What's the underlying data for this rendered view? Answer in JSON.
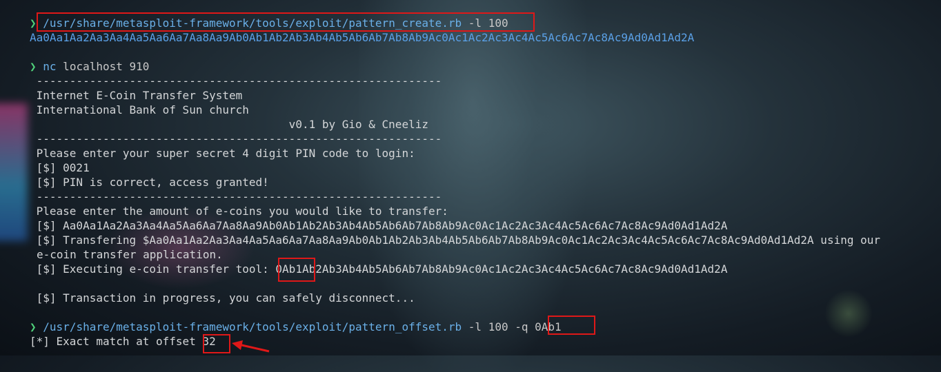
{
  "lines": {
    "cmd1": {
      "prompt": "❯",
      "cmd": "/usr/share/metasploit-framework/tools/exploit/pattern_create.rb",
      "args": " -l 100"
    },
    "pattern": "Aa0Aa1Aa2Aa3Aa4Aa5Aa6Aa7Aa8Aa9Ab0Ab1Ab2Ab3Ab4Ab5Ab6Ab7Ab8Ab9Ac0Ac1Ac2Ac3Ac4Ac5Ac6Ac7Ac8Ac9Ad0Ad1Ad2A",
    "cmd2": {
      "prompt": "❯",
      "cmd": "nc",
      "args": " localhost 910"
    },
    "sep1": " -------------------------------------------------------------",
    "title1": " Internet E-Coin Transfer System",
    "title2": " International Bank of Sun church",
    "version": "                                       v0.1 by Gio & Cneeliz",
    "sep2": " -------------------------------------------------------------",
    "pin_prompt": " Please enter your super secret 4 digit PIN code to login:",
    "pin_input": " [$] 0021",
    "pin_ok": " [$] PIN is correct, access granted!",
    "sep3": " -------------------------------------------------------------",
    "amount_prompt": " Please enter the amount of e-coins you would like to transfer:",
    "amount_input": " [$] Aa0Aa1Aa2Aa3Aa4Aa5Aa6Aa7Aa8Aa9Ab0Ab1Ab2Ab3Ab4Ab5Ab6Ab7Ab8Ab9Ac0Ac1Ac2Ac3Ac4Ac5Ac6Ac7Ac8Ac9Ad0Ad1Ad2A",
    "transfer_a": " [$] Transfering $Aa0Aa1Aa2Aa3Aa4Aa5Aa6Aa7Aa8Aa9Ab0Ab1Ab2Ab3Ab4Ab5Ab6Ab7Ab8Ab9Ac0Ac1Ac2Ac3Ac4Ac5Ac6Ac7Ac8Ac9Ad0Ad1Ad2A using our",
    "transfer_b": "e-coin transfer application.",
    "exec": " [$] Executing e-coin transfer tool: 0Ab1Ab2Ab3Ab4Ab5Ab6Ab7Ab8Ab9Ac0Ac1Ac2Ac3Ac4Ac5Ac6Ac7Ac8Ac9Ad0Ad1Ad2A",
    "txn": " [$] Transaction in progress, you can safely disconnect...",
    "cmd3": {
      "prompt": "❯",
      "cmd": "/usr/share/metasploit-framework/tools/exploit/pattern_offset.rb",
      "args": " -l 100 -q ",
      "query": "0Ab1"
    },
    "result": {
      "text": "[*] Exact match at offset ",
      "value": "32"
    }
  },
  "colors": {
    "prompt": "#4fd07a",
    "command": "#6ab0e8",
    "pattern": "#5aa0e6",
    "text": "#d4d6d8",
    "highlight": "#e01818"
  }
}
